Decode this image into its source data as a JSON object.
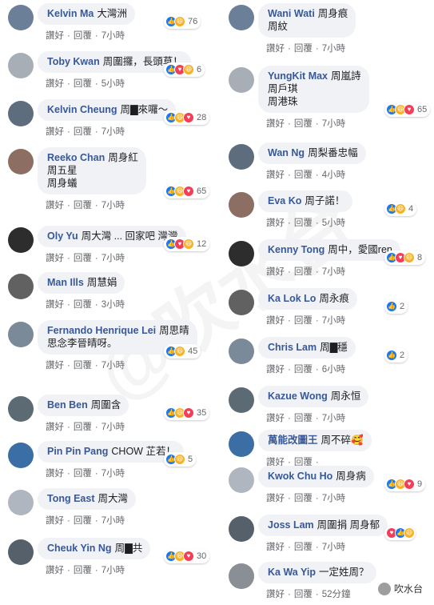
{
  "watermark": "@吹水台",
  "brand": {
    "icon": "wechat-icon",
    "label": "吹水台"
  },
  "actions": {
    "like": "讚好",
    "reply": "回覆",
    "dot": "·"
  },
  "left": [
    {
      "name": "Kelvin Ma",
      "text": "大灣洲",
      "reactions": [
        "like",
        "haha"
      ],
      "count": "76",
      "time": "7小時"
    },
    {
      "name": "Toby Kwan",
      "text": "周圍攞，長頭草！",
      "reactions": [
        "like",
        "love",
        "haha"
      ],
      "count": "6",
      "time": "5小時"
    },
    {
      "name": "Kelvin Cheung",
      "text": "周▇來囉～",
      "reactions": [
        "like",
        "haha",
        "love"
      ],
      "count": "28",
      "time": "7小時"
    },
    {
      "name": "Reeko Chan",
      "text": "周身紅",
      "line2": "周五星",
      "line3": "周身蟻",
      "reactions": [
        "like",
        "haha",
        "love"
      ],
      "count": "65",
      "time": "7小時"
    },
    {
      "name": "Oly Yu",
      "text": "周大灣 ... 回家吧 灣灣",
      "reactions": [
        "like",
        "love",
        "haha"
      ],
      "count": "12",
      "time": "7小時"
    },
    {
      "name": "Man Ills",
      "text": "周慧娟",
      "reactions": [],
      "count": "",
      "time": "3小時"
    },
    {
      "name": "Fernando Henrique Lei",
      "text": "周思晴",
      "line2": "思念李晉晴呀。",
      "reactions": [
        "like",
        "haha"
      ],
      "count": "45",
      "time": "7小時"
    },
    {
      "name": "Ben Ben",
      "text": "周圍含",
      "reactions": [
        "like",
        "haha",
        "love"
      ],
      "count": "35",
      "time": "7小時"
    },
    {
      "name": "Pin Pin Pang",
      "text": "CHOW 芷若！",
      "reactions": [
        "like",
        "haha"
      ],
      "count": "5",
      "time": "7小時"
    },
    {
      "name": "Tong East",
      "text": "周大灣",
      "reactions": [],
      "count": "",
      "time": "7小時"
    },
    {
      "name": "Cheuk Yin Ng",
      "text": "周▇共",
      "reactions": [
        "like",
        "haha",
        "love"
      ],
      "count": "30",
      "time": "7小時"
    }
  ],
  "right": [
    {
      "name": "Wani Wati",
      "text": "周身痕",
      "line2": "周紋",
      "reactions": [],
      "count": "",
      "time": "7小時"
    },
    {
      "name": "YungKit Max",
      "text": "周嵐詩",
      "line2": "周戶琪",
      "line3": "周港珠",
      "reactions": [
        "like",
        "haha",
        "love"
      ],
      "count": "65",
      "time": "7小時"
    },
    {
      "name": "Wan Ng",
      "text": "周梨番忠幅",
      "reactions": [],
      "count": "",
      "time": "4小時"
    },
    {
      "name": "Eva Ko",
      "text": "周子諾！",
      "reactions": [
        "like",
        "haha"
      ],
      "count": "4",
      "time": "5小時"
    },
    {
      "name": "Kenny Tong",
      "text": "周中，愛國ren",
      "reactions": [
        "like",
        "love",
        "haha"
      ],
      "count": "8",
      "time": "7小時"
    },
    {
      "name": "Ka Lok Lo",
      "text": "周永痕",
      "reactions": [
        "like"
      ],
      "count": "2",
      "time": "7小時"
    },
    {
      "name": "Chris Lam",
      "text": "周▇穩",
      "reactions": [
        "like"
      ],
      "count": "2",
      "time": "6小時"
    },
    {
      "name": "Kazue Wong",
      "text": "周永恒",
      "reactions": [],
      "count": "",
      "time": "7小時"
    },
    {
      "name": "萬能改圖王",
      "text": "周不碎🥰",
      "reactions": [],
      "count": "",
      "time": ""
    },
    {
      "name": "Kwok Chu Ho",
      "text": "周身病",
      "reactions": [
        "like",
        "haha",
        "love"
      ],
      "count": "9",
      "time": "7小時"
    },
    {
      "name": "Joss Lam",
      "text": "周圍捐 周身郁",
      "reactions": [
        "love",
        "like",
        "haha"
      ],
      "count": "",
      "time": "7小時"
    },
    {
      "name": "Ka Wa Yip",
      "text": "一定姓周？",
      "reactions": [],
      "count": "",
      "time": "52分鐘"
    }
  ]
}
